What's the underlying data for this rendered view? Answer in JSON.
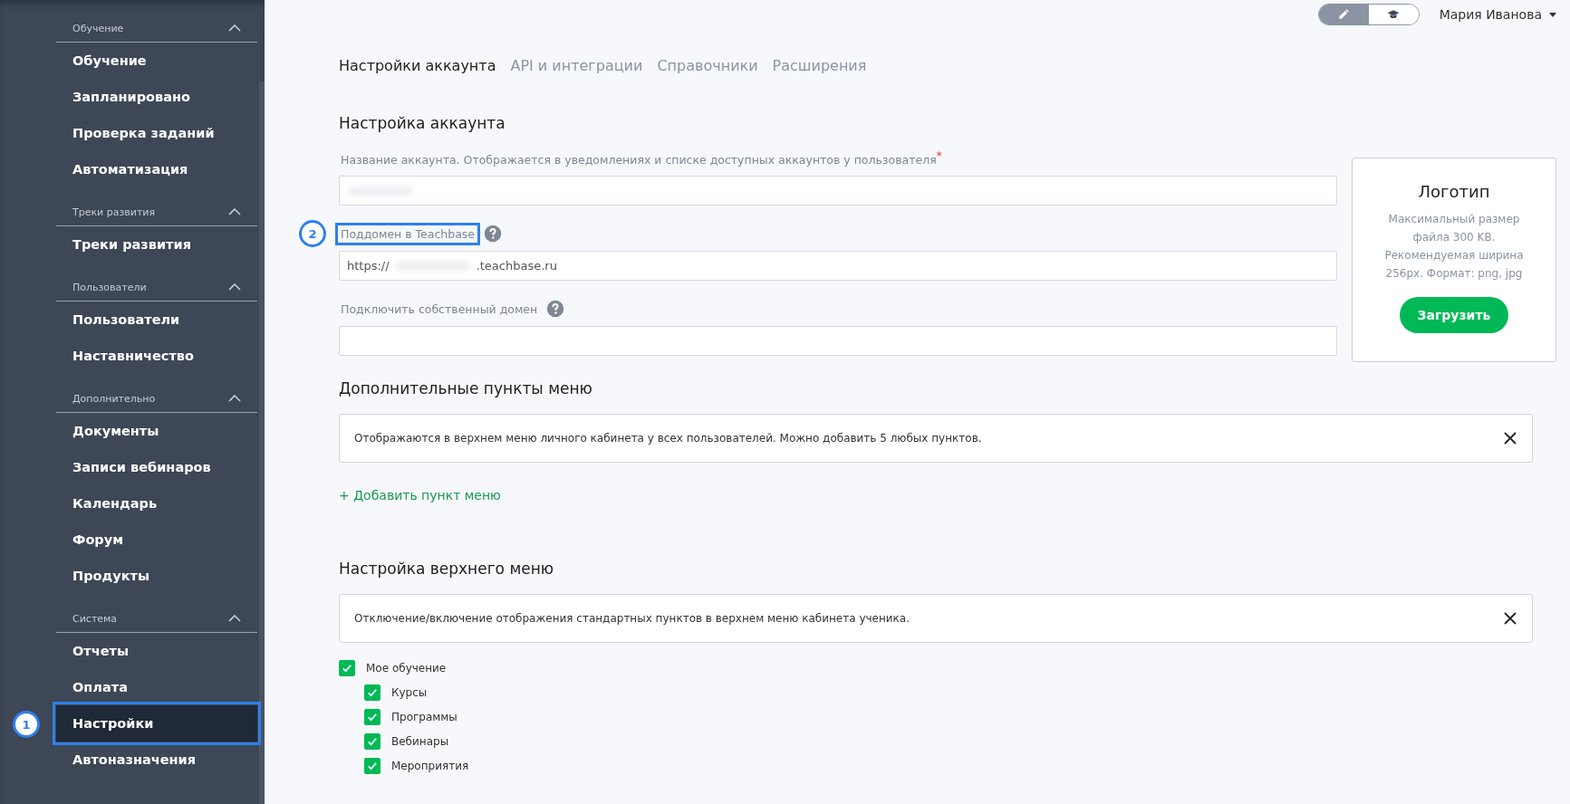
{
  "sidebar": {
    "groups": [
      {
        "title": "Обучение",
        "expanded": true,
        "items": [
          {
            "label": "Обучение",
            "selected": false
          },
          {
            "label": "Запланировано",
            "selected": false
          },
          {
            "label": "Проверка заданий",
            "selected": false
          },
          {
            "label": "Автоматизация",
            "selected": false
          }
        ]
      },
      {
        "title": "Треки развития",
        "expanded": true,
        "items": [
          {
            "label": "Треки развития",
            "selected": false
          }
        ]
      },
      {
        "title": "Пользователи",
        "expanded": true,
        "items": [
          {
            "label": "Пользователи",
            "selected": false
          },
          {
            "label": "Наставничество",
            "selected": false
          }
        ]
      },
      {
        "title": "Дополнительно",
        "expanded": true,
        "items": [
          {
            "label": "Документы",
            "selected": false
          },
          {
            "label": "Записи вебинаров",
            "selected": false
          },
          {
            "label": "Календарь",
            "selected": false
          },
          {
            "label": "Форум",
            "selected": false
          },
          {
            "label": "Продукты",
            "selected": false
          }
        ]
      },
      {
        "title": "Система",
        "expanded": true,
        "items": [
          {
            "label": "Отчеты",
            "selected": false
          },
          {
            "label": "Оплата",
            "selected": false
          },
          {
            "label": "Настройки",
            "selected": true,
            "callout": "1"
          },
          {
            "label": "Автоназначения",
            "selected": false
          }
        ]
      }
    ]
  },
  "header": {
    "mode_toggle": [
      {
        "selected": true
      },
      {
        "selected": false
      }
    ],
    "user_name": "Мария Иванова"
  },
  "tabs": [
    {
      "label": "Настройки аккаунта",
      "selected": true
    },
    {
      "label": "API и интеграции",
      "selected": false
    },
    {
      "label": "Справочники",
      "selected": false
    },
    {
      "label": "Расширения",
      "selected": false
    }
  ],
  "account": {
    "title": "Настройка аккаунта",
    "fields": [
      {
        "label": "Название аккаунта. Отображается в уведомлениях и списке доступных аккаунтов у пользователя",
        "required_mark": "*",
        "help": false,
        "blurred": true
      },
      {
        "label": "Поддомен в Teachbase",
        "help": true,
        "callout": "2",
        "value_prefix": "https://",
        "value_suffix": ".teachbase.ru",
        "blurred": true
      },
      {
        "label": "Подключить собственный домен",
        "help": true,
        "blurred": false
      }
    ]
  },
  "logo": {
    "title": "Логотип",
    "description": "Максимальный размер файла 300 KB. Рекомендуемая ширина 256px. Формат: png, jpg",
    "button": "Загрузить"
  },
  "extra_menu": {
    "title": "Дополнительные пункты меню",
    "notice": "Отображаются в верхнем меню личного кабинета у всех пользователей. Можно добавить 5 любых пунктов.",
    "add_link": "+ Добавить пункт меню"
  },
  "top_menu": {
    "title": "Настройка верхнего меню",
    "notice": "Отключение/включение отображения стандартных пунктов в верхнем меню кабинета ученика.",
    "items": [
      {
        "label": "Мое обучение",
        "checked": true,
        "children": [
          {
            "label": "Курсы",
            "checked": true
          },
          {
            "label": "Программы",
            "checked": true
          },
          {
            "label": "Вебинары",
            "checked": true
          },
          {
            "label": "Мероприятия",
            "checked": true
          }
        ]
      }
    ]
  }
}
